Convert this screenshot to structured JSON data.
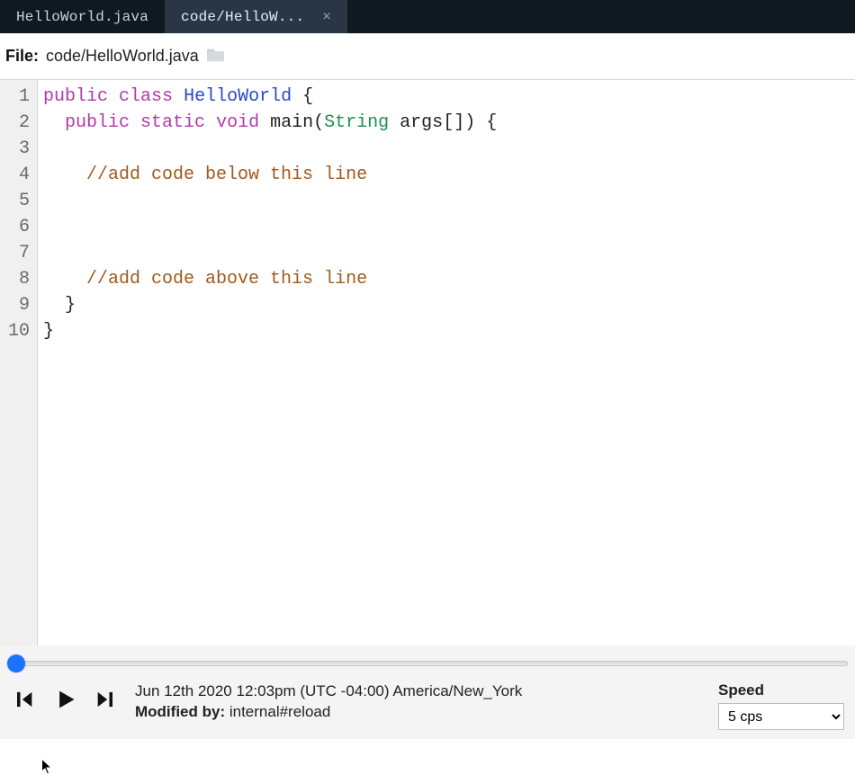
{
  "tabs": [
    {
      "label": "HelloWorld.java",
      "selected": false,
      "closeable": false
    },
    {
      "label": "code/HelloW...",
      "selected": true,
      "closeable": true
    }
  ],
  "file": {
    "label": "File:",
    "path": "code/HelloWorld.java"
  },
  "gutter": {
    "start": 1,
    "end": 10
  },
  "code_lines": [
    [
      {
        "t": "kw",
        "v": "public"
      },
      {
        "t": "sp",
        "v": " "
      },
      {
        "t": "kw",
        "v": "class"
      },
      {
        "t": "sp",
        "v": " "
      },
      {
        "t": "class",
        "v": "HelloWorld"
      },
      {
        "t": "sp",
        "v": " "
      },
      {
        "t": "punc",
        "v": "{"
      }
    ],
    [
      {
        "t": "sp",
        "v": "  "
      },
      {
        "t": "kw",
        "v": "public"
      },
      {
        "t": "sp",
        "v": " "
      },
      {
        "t": "kw",
        "v": "static"
      },
      {
        "t": "sp",
        "v": " "
      },
      {
        "t": "kw",
        "v": "void"
      },
      {
        "t": "sp",
        "v": " "
      },
      {
        "t": "ident",
        "v": "main"
      },
      {
        "t": "punc",
        "v": "("
      },
      {
        "t": "type",
        "v": "String"
      },
      {
        "t": "sp",
        "v": " "
      },
      {
        "t": "ident",
        "v": "args"
      },
      {
        "t": "punc",
        "v": "[])"
      },
      {
        "t": "sp",
        "v": " "
      },
      {
        "t": "punc",
        "v": "{"
      }
    ],
    [
      {
        "t": "sp",
        "v": "    "
      }
    ],
    [
      {
        "t": "sp",
        "v": "    "
      },
      {
        "t": "comment",
        "v": "//add code below this line"
      }
    ],
    [
      {
        "t": "sp",
        "v": ""
      }
    ],
    [
      {
        "t": "sp",
        "v": ""
      }
    ],
    [
      {
        "t": "sp",
        "v": ""
      }
    ],
    [
      {
        "t": "sp",
        "v": "    "
      },
      {
        "t": "comment",
        "v": "//add code above this line"
      }
    ],
    [
      {
        "t": "sp",
        "v": "  "
      },
      {
        "t": "punc",
        "v": "}"
      }
    ],
    [
      {
        "t": "punc",
        "v": "}"
      }
    ]
  ],
  "playback": {
    "timestamp": "Jun 12th 2020 12:03pm (UTC -04:00) America/New_York",
    "modified_label": "Modified by:",
    "modified_value": "internal#reload",
    "speed_label": "Speed",
    "speed_selected": "5 cps",
    "speed_options": [
      "5 cps"
    ]
  },
  "colors": {
    "tabbar_bg": "#101820",
    "tab_selected_bg": "#283645",
    "gutter_bg": "#f0f0f0",
    "scrub_thumb": "#1a74ff",
    "keyword": "#b33aa8",
    "type": "#1f8f4e",
    "classname": "#2a48c8",
    "comment": "#a05a1c"
  }
}
